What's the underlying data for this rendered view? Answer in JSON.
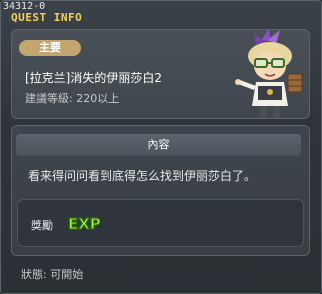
{
  "window": {
    "quest_id": "34312-0",
    "title": "QUEST INFO"
  },
  "quest": {
    "category_badge": "主要",
    "name": "[拉克兰]消失的伊丽莎白2",
    "level_requirement": "建議等級: 220以上"
  },
  "content": {
    "header": "內容",
    "description": "看来得问问看到底得怎么找到伊丽莎白了。"
  },
  "reward": {
    "label": "獎勵",
    "exp_text": "EXP"
  },
  "status": {
    "text": "狀態: 可開始"
  },
  "colors": {
    "title": "#f0d25a",
    "badge": "#c3a66d",
    "exp": "#9cff3a"
  }
}
